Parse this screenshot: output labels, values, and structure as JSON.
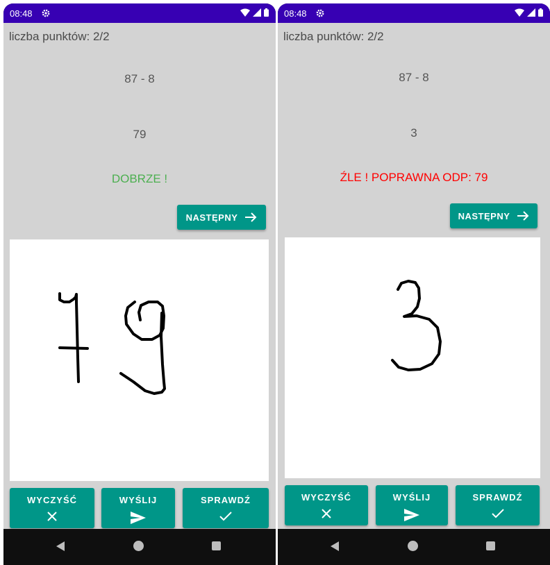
{
  "colors": {
    "status_bar": "#3700b3",
    "screen_bg": "#d3d3d3",
    "accent_teal": "#009688",
    "correct": "#4caf50",
    "wrong": "#ff0000"
  },
  "phones": [
    {
      "status": {
        "time": "08:48"
      },
      "score_label": "liczba punktów: 2/2",
      "equation": "87 - 8",
      "recognized_answer": "79",
      "result_message": "DOBRZE !",
      "result_type": "correct",
      "next_button": {
        "label": "NASTĘPNY",
        "icon": "arrow-right-icon"
      },
      "canvas_drawing": "handwritten digits 79",
      "actions": [
        {
          "label": "WYCZYŚĆ",
          "icon": "close-icon"
        },
        {
          "label": "WYŚLIJ",
          "icon": "send-icon"
        },
        {
          "label": "SPRAWDŹ",
          "icon": "check-icon"
        }
      ]
    },
    {
      "status": {
        "time": "08:48"
      },
      "score_label": "liczba punktów: 2/2",
      "equation": "87 - 8",
      "recognized_answer": "3",
      "result_message": "ŹLE ! POPRAWNA ODP: 79",
      "result_type": "wrong",
      "next_button": {
        "label": "NASTĘPNY",
        "icon": "arrow-right-icon"
      },
      "canvas_drawing": "handwritten digit 3",
      "actions": [
        {
          "label": "WYCZYŚĆ",
          "icon": "close-icon"
        },
        {
          "label": "WYŚLIJ",
          "icon": "send-icon"
        },
        {
          "label": "SPRAWDŹ",
          "icon": "check-icon"
        }
      ]
    }
  ]
}
